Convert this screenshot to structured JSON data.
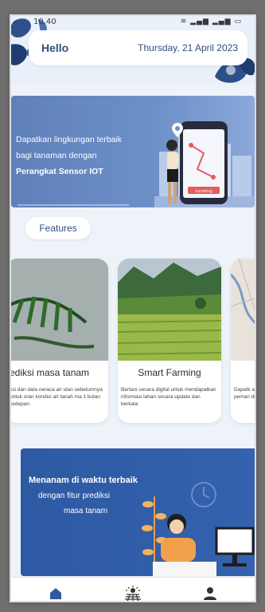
{
  "status_bar": {
    "time": "10.40",
    "icons": "wifi-icon signal-icon signal-icon battery-icon"
  },
  "header": {
    "greeting": "Hello",
    "date": "Thursday, 21 April 2023"
  },
  "banner_iot": {
    "line1": "Dapatkan lingkungan terbaik",
    "line2": "bagi tanaman dengan",
    "line3": "Perangkat Sensor IOT",
    "phone_button": "Locating"
  },
  "features": {
    "label": "Features"
  },
  "cards": [
    {
      "title": "rediksi masa tanam",
      "description": "ksi dan data neraca air ulan sebelumnya untuk oran kondisi air tanah ma 1 bulan kedepan"
    },
    {
      "title": "Smart Farming",
      "description": "Bertani secara digital untuk mendapatkan informasi lahan secara update dan berkala"
    },
    {
      "title": "",
      "description": "Dapatk agar leb peman digital"
    }
  ],
  "banner_predict": {
    "line1": "Menanam di waktu terbaik",
    "line2": "dengan fitur prediksi",
    "line3": "masa tanam"
  },
  "navbar": {
    "items": [
      "home-icon",
      "farm-icon",
      "profile-icon"
    ],
    "active_color": "#2f5aa3"
  },
  "colors": {
    "primary": "#2f5aa3",
    "header_text": "#2f4f7e",
    "background": "#eef3fa"
  }
}
